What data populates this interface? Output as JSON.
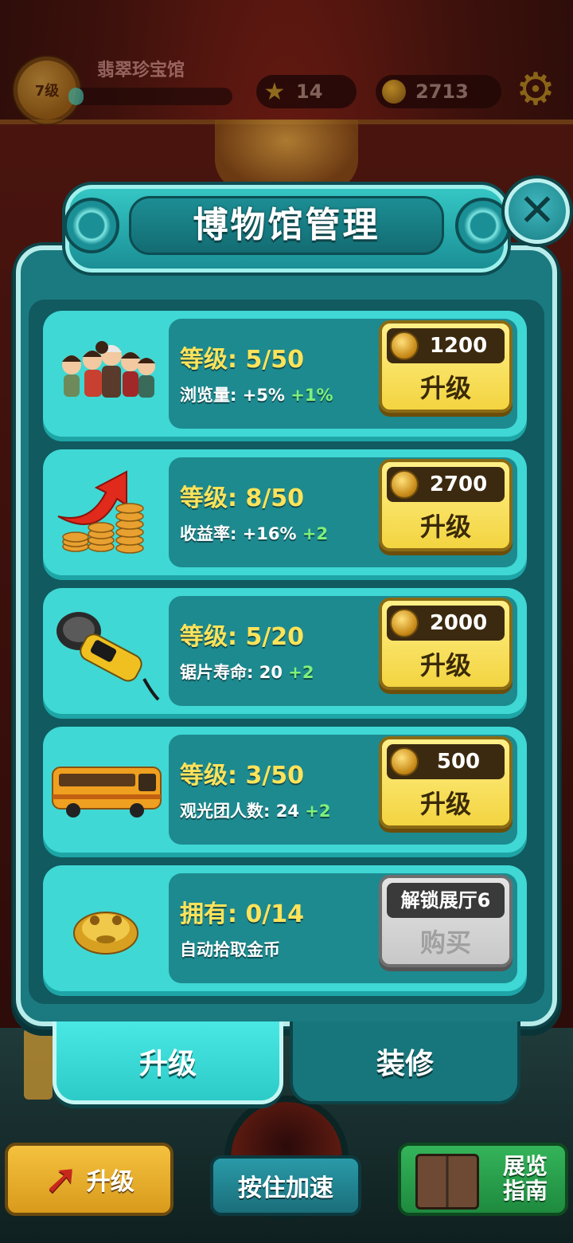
{
  "header": {
    "level_badge": "7级",
    "museum_name": "翡翠珍宝馆",
    "xp_progress": 0.09,
    "stars": "14",
    "coins": "2713"
  },
  "panel": {
    "title": "博物馆管理"
  },
  "cards": [
    {
      "image": "visitors-group-icon",
      "level": "等级: 5/50",
      "desc_prefix": "浏览量: +5%",
      "bonus": "+1%",
      "price": "1200",
      "button": "升级"
    },
    {
      "image": "income-arrow-coins-icon",
      "level": "等级: 8/50",
      "desc_prefix": "收益率: +16%",
      "bonus": "+2",
      "price": "2700",
      "button": "升级"
    },
    {
      "image": "angle-grinder-icon",
      "level": "等级: 5/20",
      "desc_prefix": "锯片寿命: 20",
      "bonus": "+2",
      "price": "2000",
      "button": "升级"
    },
    {
      "image": "tour-bus-icon",
      "level": "等级: 3/50",
      "desc_prefix": "观光团人数: 24",
      "bonus": "+2",
      "price": "500",
      "button": "升级"
    },
    {
      "image": "golden-toad-icon",
      "level": "拥有: 0/14",
      "desc_prefix": "自动拾取金币",
      "bonus": "",
      "lock_label": "解锁展厅6",
      "button": "购买"
    }
  ],
  "tabs": {
    "upgrade": "升级",
    "decorate": "装修"
  },
  "bottom": {
    "upgrade": "升级",
    "speed_up": "按住加速",
    "guide_line1": "展览",
    "guide_line2": "指南"
  },
  "colors": {
    "panel": "#1a7a80",
    "card": "#3fd8d4",
    "button_gold": "#f3d440",
    "level_text": "#ffe35a",
    "bonus_text": "#7ef07a"
  }
}
